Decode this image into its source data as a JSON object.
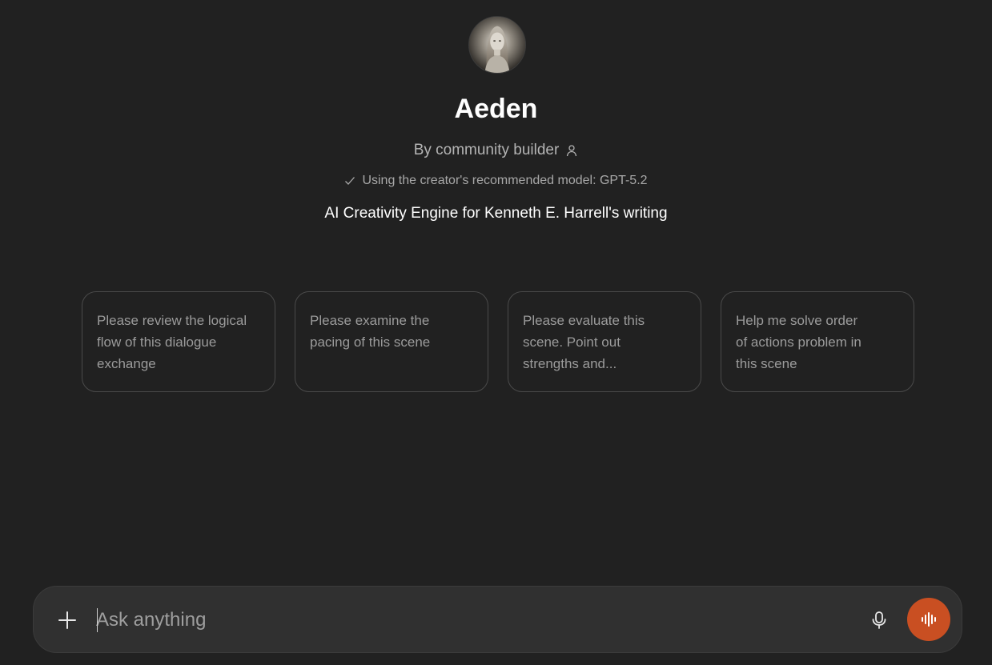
{
  "gpt": {
    "name": "Aeden",
    "byline": "By community builder",
    "model_notice": "Using the creator's recommended model: GPT-5.2",
    "description": "AI Creativity Engine for Kenneth E. Harrell's writing"
  },
  "starters": [
    {
      "label": "Please review the logical flow of this dialogue exchange"
    },
    {
      "label": "Please examine the pacing of this scene"
    },
    {
      "label": "Please evaluate this scene. Point out strengths and..."
    },
    {
      "label": "Help me solve order of actions problem in this scene"
    }
  ],
  "composer": {
    "placeholder": "Ask anything",
    "value": ""
  },
  "colors": {
    "background": "#212121",
    "composer": "#303030",
    "voice_accent": "#c94f22"
  },
  "icons": {
    "avatar": "gpt-avatar",
    "byline": "person-icon",
    "model_notice": "check-icon",
    "attach": "plus-icon",
    "dictate": "microphone-icon",
    "voice": "voice-waveform-icon"
  }
}
